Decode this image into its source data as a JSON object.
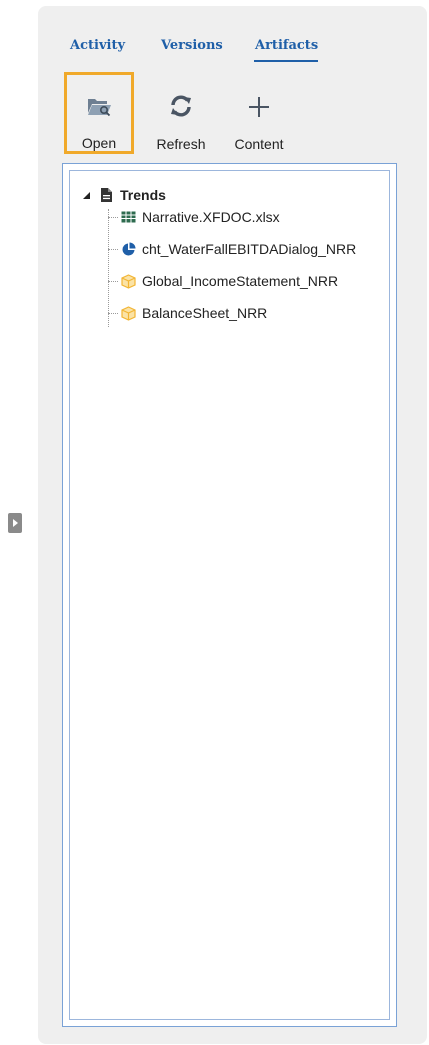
{
  "tabs": [
    {
      "label": "Activity",
      "active": false
    },
    {
      "label": "Versions",
      "active": false
    },
    {
      "label": "Artifacts",
      "active": true
    }
  ],
  "toolbar": {
    "open_label": "Open",
    "refresh_label": "Refresh",
    "content_label": "Content",
    "open_icon": "folder-open-icon",
    "refresh_icon": "refresh-icon",
    "content_icon": "plus-icon"
  },
  "tree": {
    "root": {
      "label": "Trends",
      "icon": "document-icon",
      "expanded": true
    },
    "children": [
      {
        "label": "Narrative.XFDOC.xlsx",
        "icon": "spreadsheet-icon"
      },
      {
        "label": "cht_WaterFallEBITDADialog_NRR",
        "icon": "pie-chart-icon"
      },
      {
        "label": "Global_IncomeStatement_NRR",
        "icon": "cube-icon"
      },
      {
        "label": "BalanceSheet_NRR",
        "icon": "cube-icon"
      }
    ]
  },
  "colors": {
    "tab_text": "#1f5fa8",
    "selected_outline": "#f0a92a",
    "tree_border": "#7aa2d6",
    "panel_bg": "#efefef",
    "cube_icon": "#f2b534",
    "spreadsheet_icon": "#2e6b4f",
    "chart_icon": "#1f5fa8"
  }
}
